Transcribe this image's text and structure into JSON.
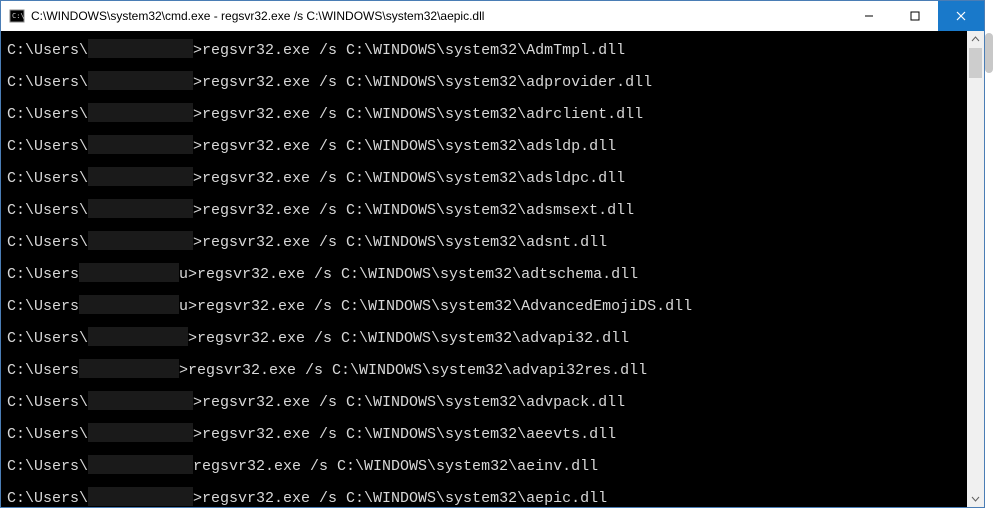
{
  "titlebar": {
    "title": "C:\\WINDOWS\\system32\\cmd.exe - regsvr32.exe  /s C:\\WINDOWS\\system32\\aepic.dll",
    "icon": "cmd-icon"
  },
  "controls": {
    "minimize": "minimize",
    "maximize": "maximize",
    "close": "close"
  },
  "lines": [
    {
      "prefix": "C:\\Users\\",
      "redact_w": 105,
      "suffix": ">regsvr32.exe /s C:\\WINDOWS\\system32\\AdmTmpl.dll"
    },
    {
      "prefix": "C:\\Users\\",
      "redact_w": 105,
      "suffix": ">regsvr32.exe /s C:\\WINDOWS\\system32\\adprovider.dll"
    },
    {
      "prefix": "C:\\Users\\",
      "redact_w": 105,
      "suffix": ">regsvr32.exe /s C:\\WINDOWS\\system32\\adrclient.dll"
    },
    {
      "prefix": "C:\\Users\\",
      "redact_w": 105,
      "suffix": ">regsvr32.exe /s C:\\WINDOWS\\system32\\adsldp.dll"
    },
    {
      "prefix": "C:\\Users\\",
      "redact_w": 105,
      "suffix": ">regsvr32.exe /s C:\\WINDOWS\\system32\\adsldpc.dll"
    },
    {
      "prefix": "C:\\Users\\",
      "redact_w": 105,
      "suffix": ">regsvr32.exe /s C:\\WINDOWS\\system32\\adsmsext.dll"
    },
    {
      "prefix": "C:\\Users\\",
      "redact_w": 105,
      "suffix": ">regsvr32.exe /s C:\\WINDOWS\\system32\\adsnt.dll"
    },
    {
      "prefix": "C:\\Users",
      "redact_w": 100,
      "suffix": "u>regsvr32.exe /s C:\\WINDOWS\\system32\\adtschema.dll"
    },
    {
      "prefix": "C:\\Users",
      "redact_w": 100,
      "suffix": "u>regsvr32.exe /s C:\\WINDOWS\\system32\\AdvancedEmojiDS.dll"
    },
    {
      "prefix": "C:\\Users\\",
      "redact_w": 100,
      "suffix": ">regsvr32.exe /s C:\\WINDOWS\\system32\\advapi32.dll"
    },
    {
      "prefix": "C:\\Users",
      "redact_w": 100,
      "suffix": ">regsvr32.exe /s C:\\WINDOWS\\system32\\advapi32res.dll"
    },
    {
      "prefix": "C:\\Users\\",
      "redact_w": 105,
      "suffix": ">regsvr32.exe /s C:\\WINDOWS\\system32\\advpack.dll"
    },
    {
      "prefix": "C:\\Users\\",
      "redact_w": 105,
      "suffix": ">regsvr32.exe /s C:\\WINDOWS\\system32\\aeevts.dll"
    },
    {
      "prefix": "C:\\Users\\",
      "redact_w": 105,
      "suffix": "regsvr32.exe /s C:\\WINDOWS\\system32\\aeinv.dll"
    },
    {
      "prefix": "C:\\Users\\",
      "redact_w": 105,
      "suffix": ">regsvr32.exe /s C:\\WINDOWS\\system32\\aepic.dll"
    }
  ]
}
